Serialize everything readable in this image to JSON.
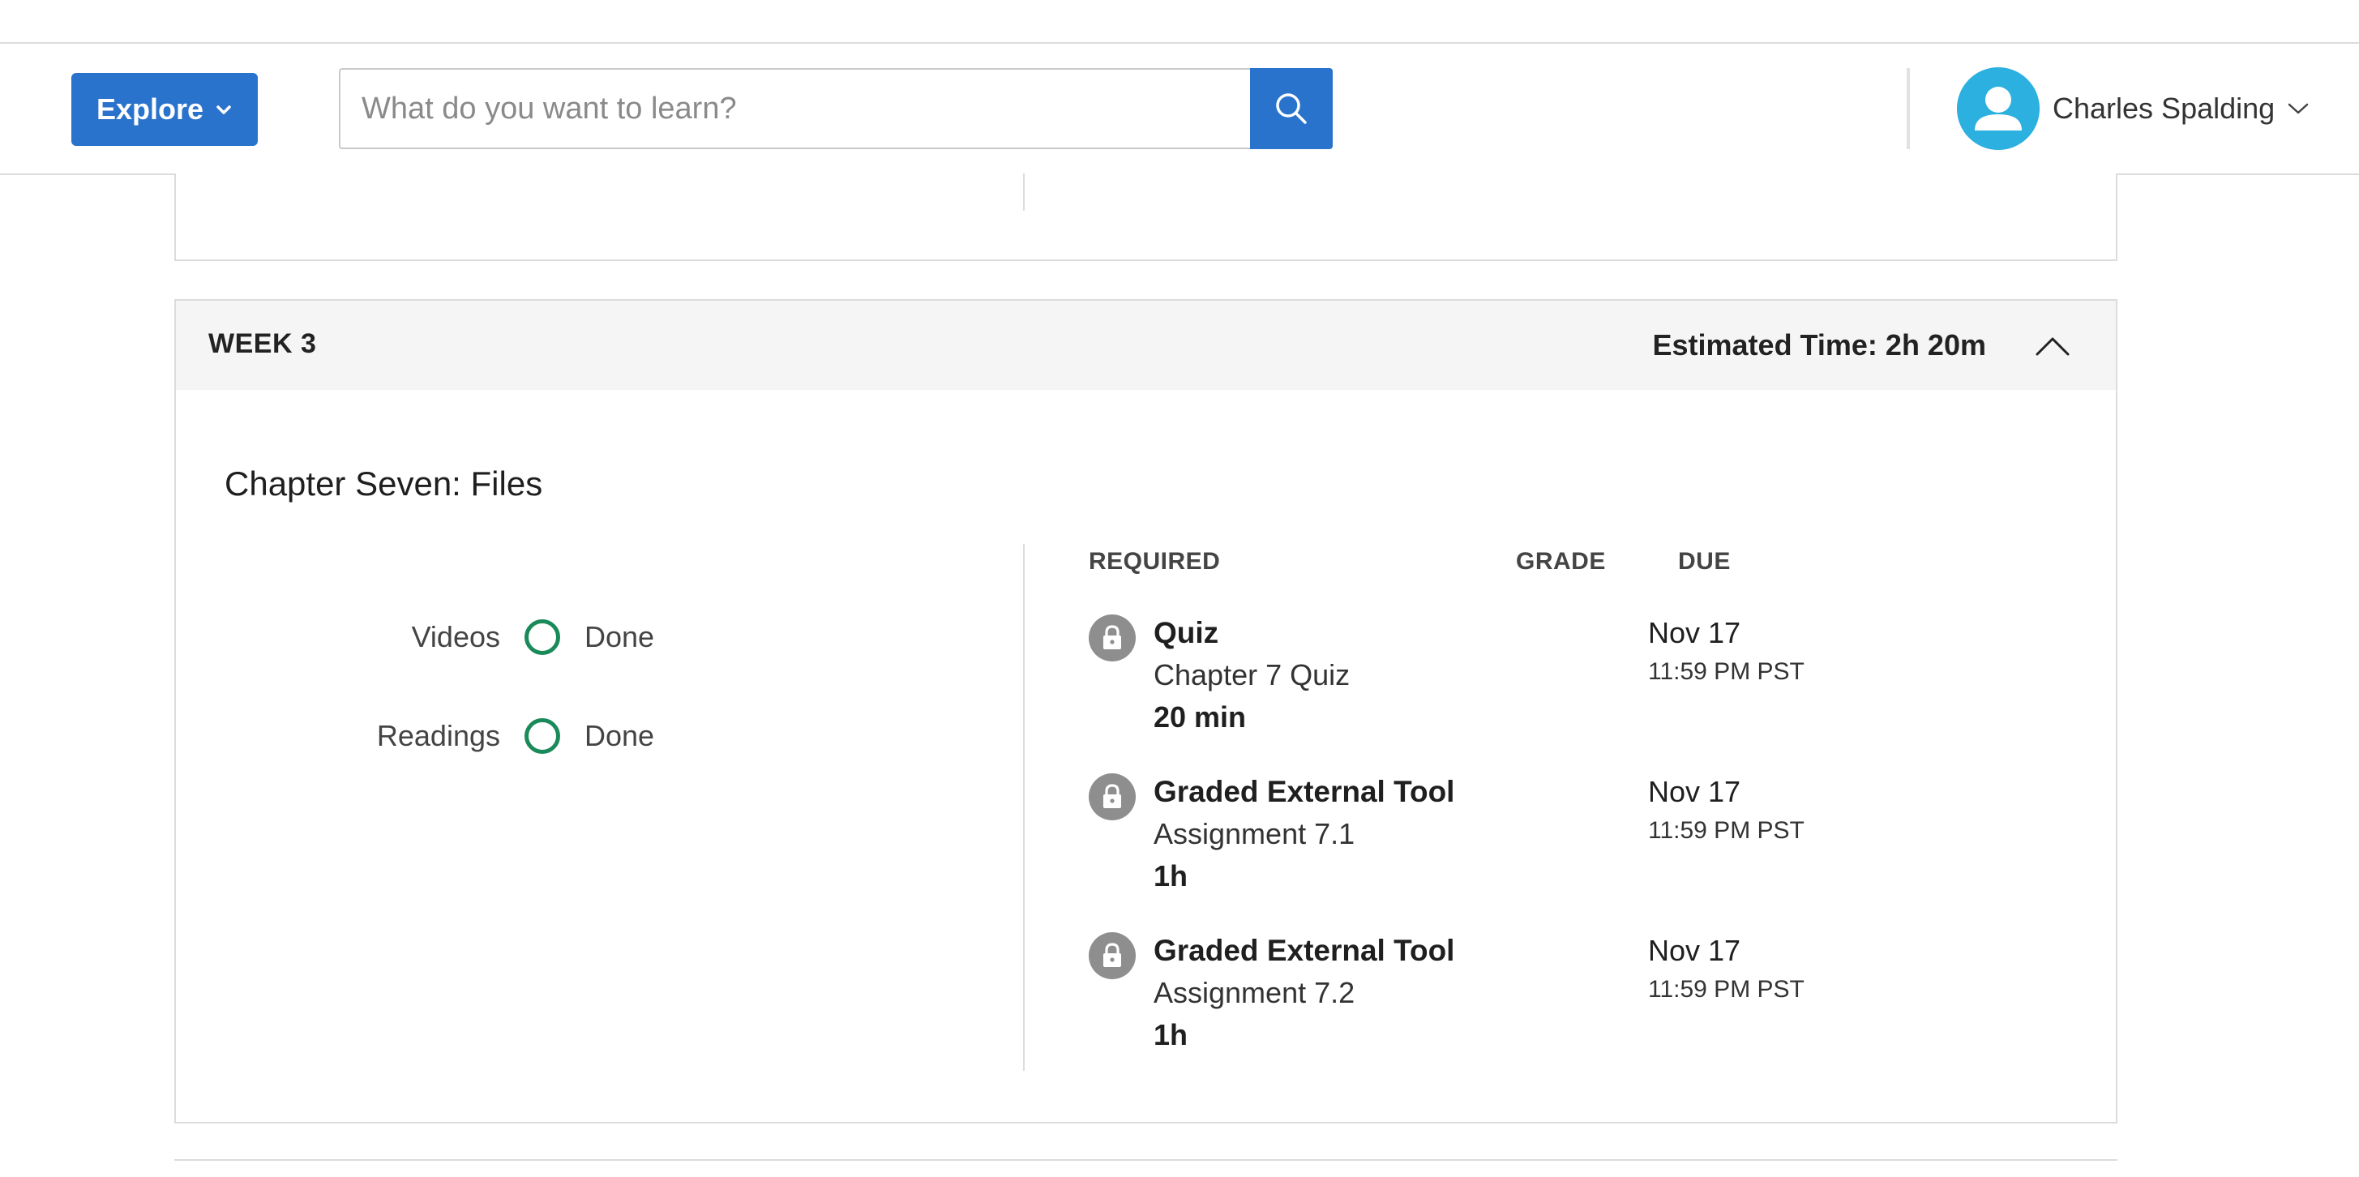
{
  "header": {
    "explore_label": "Explore",
    "search_placeholder": "What do you want to learn?",
    "user_name": "Charles Spalding"
  },
  "week": {
    "title": "WEEK 3",
    "estimated_time": "Estimated Time: 2h 20m",
    "chapter_title": "Chapter Seven: Files",
    "progress": [
      {
        "label": "Videos",
        "status": "Done"
      },
      {
        "label": "Readings",
        "status": "Done"
      }
    ],
    "columns": {
      "required": "REQUIRED",
      "grade": "GRADE",
      "due": "DUE"
    },
    "items": [
      {
        "type": "Quiz",
        "name": "Chapter 7 Quiz",
        "duration": "20 min",
        "due_date": "Nov 17",
        "due_time": "11:59 PM PST"
      },
      {
        "type": "Graded External Tool",
        "name": "Assignment 7.1",
        "duration": "1h",
        "due_date": "Nov 17",
        "due_time": "11:59 PM PST"
      },
      {
        "type": "Graded External Tool",
        "name": "Assignment 7.2",
        "duration": "1h",
        "due_date": "Nov 17",
        "due_time": "11:59 PM PST"
      }
    ]
  },
  "icons": {
    "explore_chevron": "chevron-down-icon",
    "search": "search-icon",
    "avatar": "user-avatar-icon",
    "user_chevron": "chevron-down-icon",
    "collapse": "chevron-up-icon",
    "progress": "empty-circle-icon",
    "item_status": "lock-icon"
  },
  "colors": {
    "primary": "#2a73cc",
    "avatar": "#2bb0e0",
    "progress_ring": "#1a8a5a",
    "lock_bg": "#8e8e8e",
    "week_header_bg": "#f5f5f5"
  }
}
